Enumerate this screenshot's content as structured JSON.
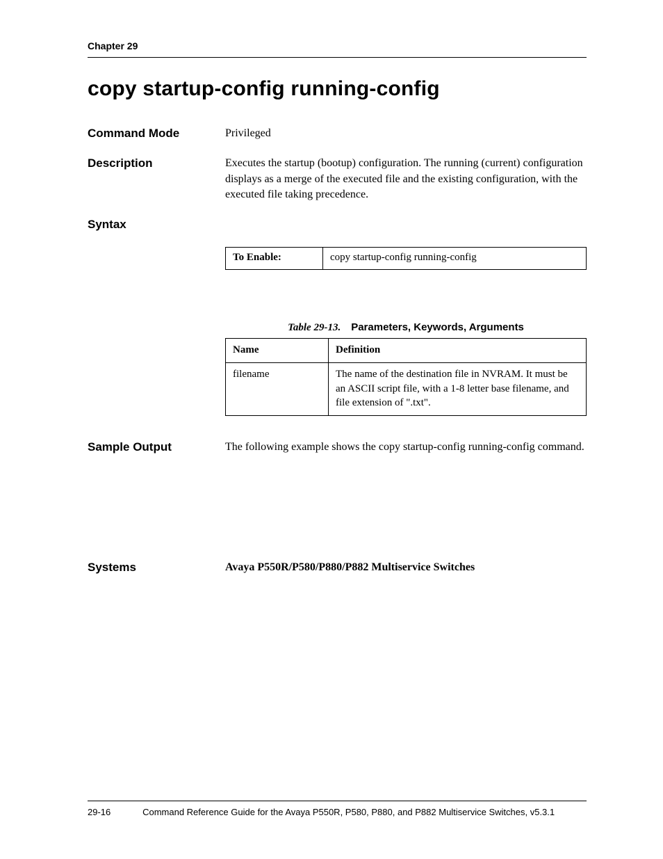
{
  "header": {
    "running": "Chapter 29"
  },
  "title": "copy startup-config running-config",
  "sections": {
    "command_mode": {
      "label": "Command Mode",
      "value": "Privileged"
    },
    "description": {
      "label": "Description",
      "value": "Executes the startup (bootup) configuration. The running (current) configuration displays as a merge of the executed file and the existing configuration, with the executed file taking precedence."
    },
    "syntax": {
      "label": "Syntax",
      "table": {
        "left": "To Enable:",
        "right": "copy startup-config running-config"
      }
    },
    "params_caption": {
      "number": "Table 29-13.",
      "title": "Parameters, Keywords, Arguments"
    },
    "params_table": {
      "headers": {
        "name": "Name",
        "definition": "Definition"
      },
      "rows": [
        {
          "name": "filename",
          "definition": "The name of the destination file in NVRAM. It must be an ASCII script file, with a 1-8 letter base filename, and file extension of \".txt\"."
        }
      ]
    },
    "sample_output": {
      "label": "Sample Output",
      "value": "The following example shows the copy startup-config running-config command."
    },
    "systems": {
      "label": "Systems",
      "value": "Avaya P550R/P580/P880/P882 Multiservice Switches"
    }
  },
  "footer": {
    "page": "29-16",
    "title": "Command Reference Guide for the Avaya P550R, P580, P880, and P882 Multiservice Switches, v5.3.1"
  }
}
